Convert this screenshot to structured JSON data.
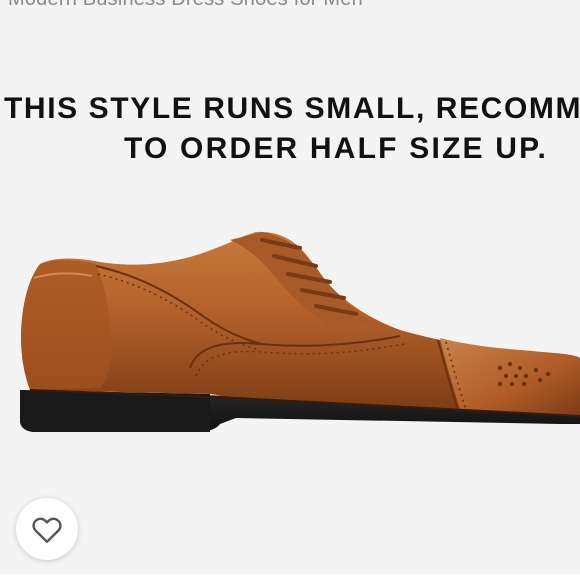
{
  "listing": {
    "title": "Modern Business Dress Shoes for Men"
  },
  "image": {
    "notice_line1": "THIS STYLE RUNS SMALL, RECOMM",
    "notice_line2": "TO ORDER HALF SIZE UP.",
    "subject": "brown-leather-oxford-shoe"
  },
  "actions": {
    "favorite_icon": "heart-outline-icon"
  },
  "colors": {
    "leather": "#b8642a",
    "leather_dark": "#7a3a14",
    "sole": "#1c1c1c",
    "background": "#f4f4f4"
  }
}
